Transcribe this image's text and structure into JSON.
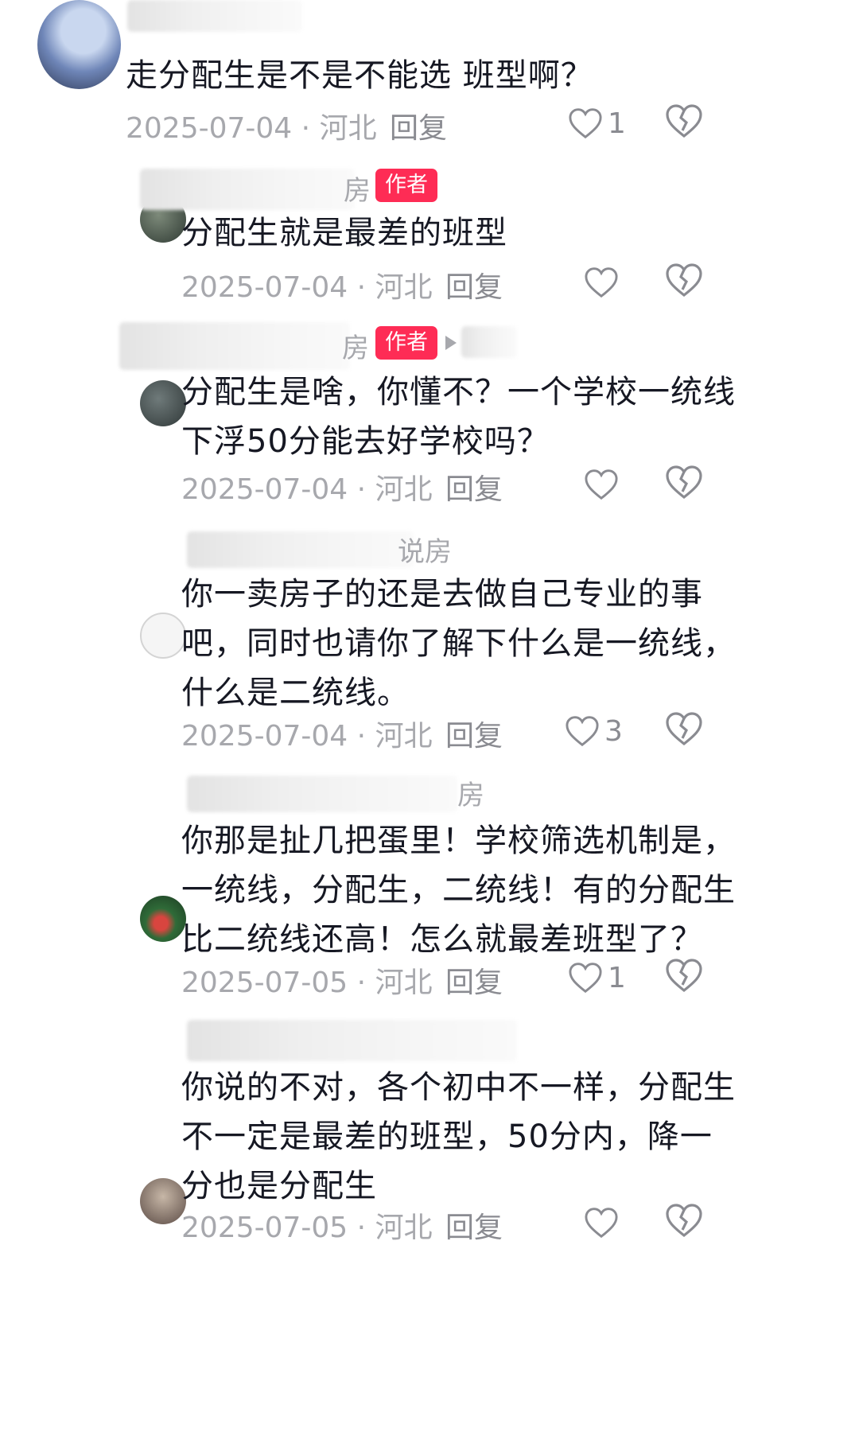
{
  "comments": [
    {
      "name_visible": "",
      "is_author": false,
      "text": "走分配生是不是不能选 班型啊？",
      "date": "2025-07-04",
      "location": "河北",
      "reply_label": "回复",
      "likes": "1"
    },
    {
      "name_visible": "房",
      "is_author": true,
      "text": "分配生就是最差的班型",
      "date": "2025-07-04",
      "location": "河北",
      "reply_label": "回复",
      "likes": ""
    },
    {
      "name_visible": "房",
      "is_author": true,
      "text": "分配生是啥，你懂不？一个学校一统线\n下浮50分能去好学校吗？",
      "date": "2025-07-04",
      "location": "河北",
      "reply_label": "回复",
      "likes": ""
    },
    {
      "name_visible": "说房",
      "is_author": false,
      "text": "你一卖房子的还是去做自己专业的事\n吧，同时也请你了解下什么是一统线，\n什么是二统线。",
      "date": "2025-07-04",
      "location": "河北",
      "reply_label": "回复",
      "likes": "3"
    },
    {
      "name_visible": "房",
      "is_author": false,
      "text": "你那是扯几把蛋里！学校筛选机制是，\n一统线，分配生，二统线！有的分配生\n比二统线还高！怎么就最差班型了？",
      "date": "2025-07-05",
      "location": "河北",
      "reply_label": "回复",
      "likes": "1"
    },
    {
      "name_visible": "",
      "is_author": false,
      "text": "你说的不对，各个初中不一样，分配生\n不一定是最差的班型，50分内，降一\n分也是分配生",
      "date": "2025-07-05",
      "location": "河北",
      "reply_label": "回复",
      "likes": ""
    }
  ],
  "labels": {
    "author_tag": "作者",
    "separator": "·"
  },
  "colors": {
    "author_tag": "#fe2c55",
    "meta_text": "#a7a8ad",
    "body_text": "#161823"
  },
  "icons": {
    "like": "heart-outline-icon",
    "dislike": "broken-heart-icon",
    "expand": "play-arrow-icon"
  }
}
